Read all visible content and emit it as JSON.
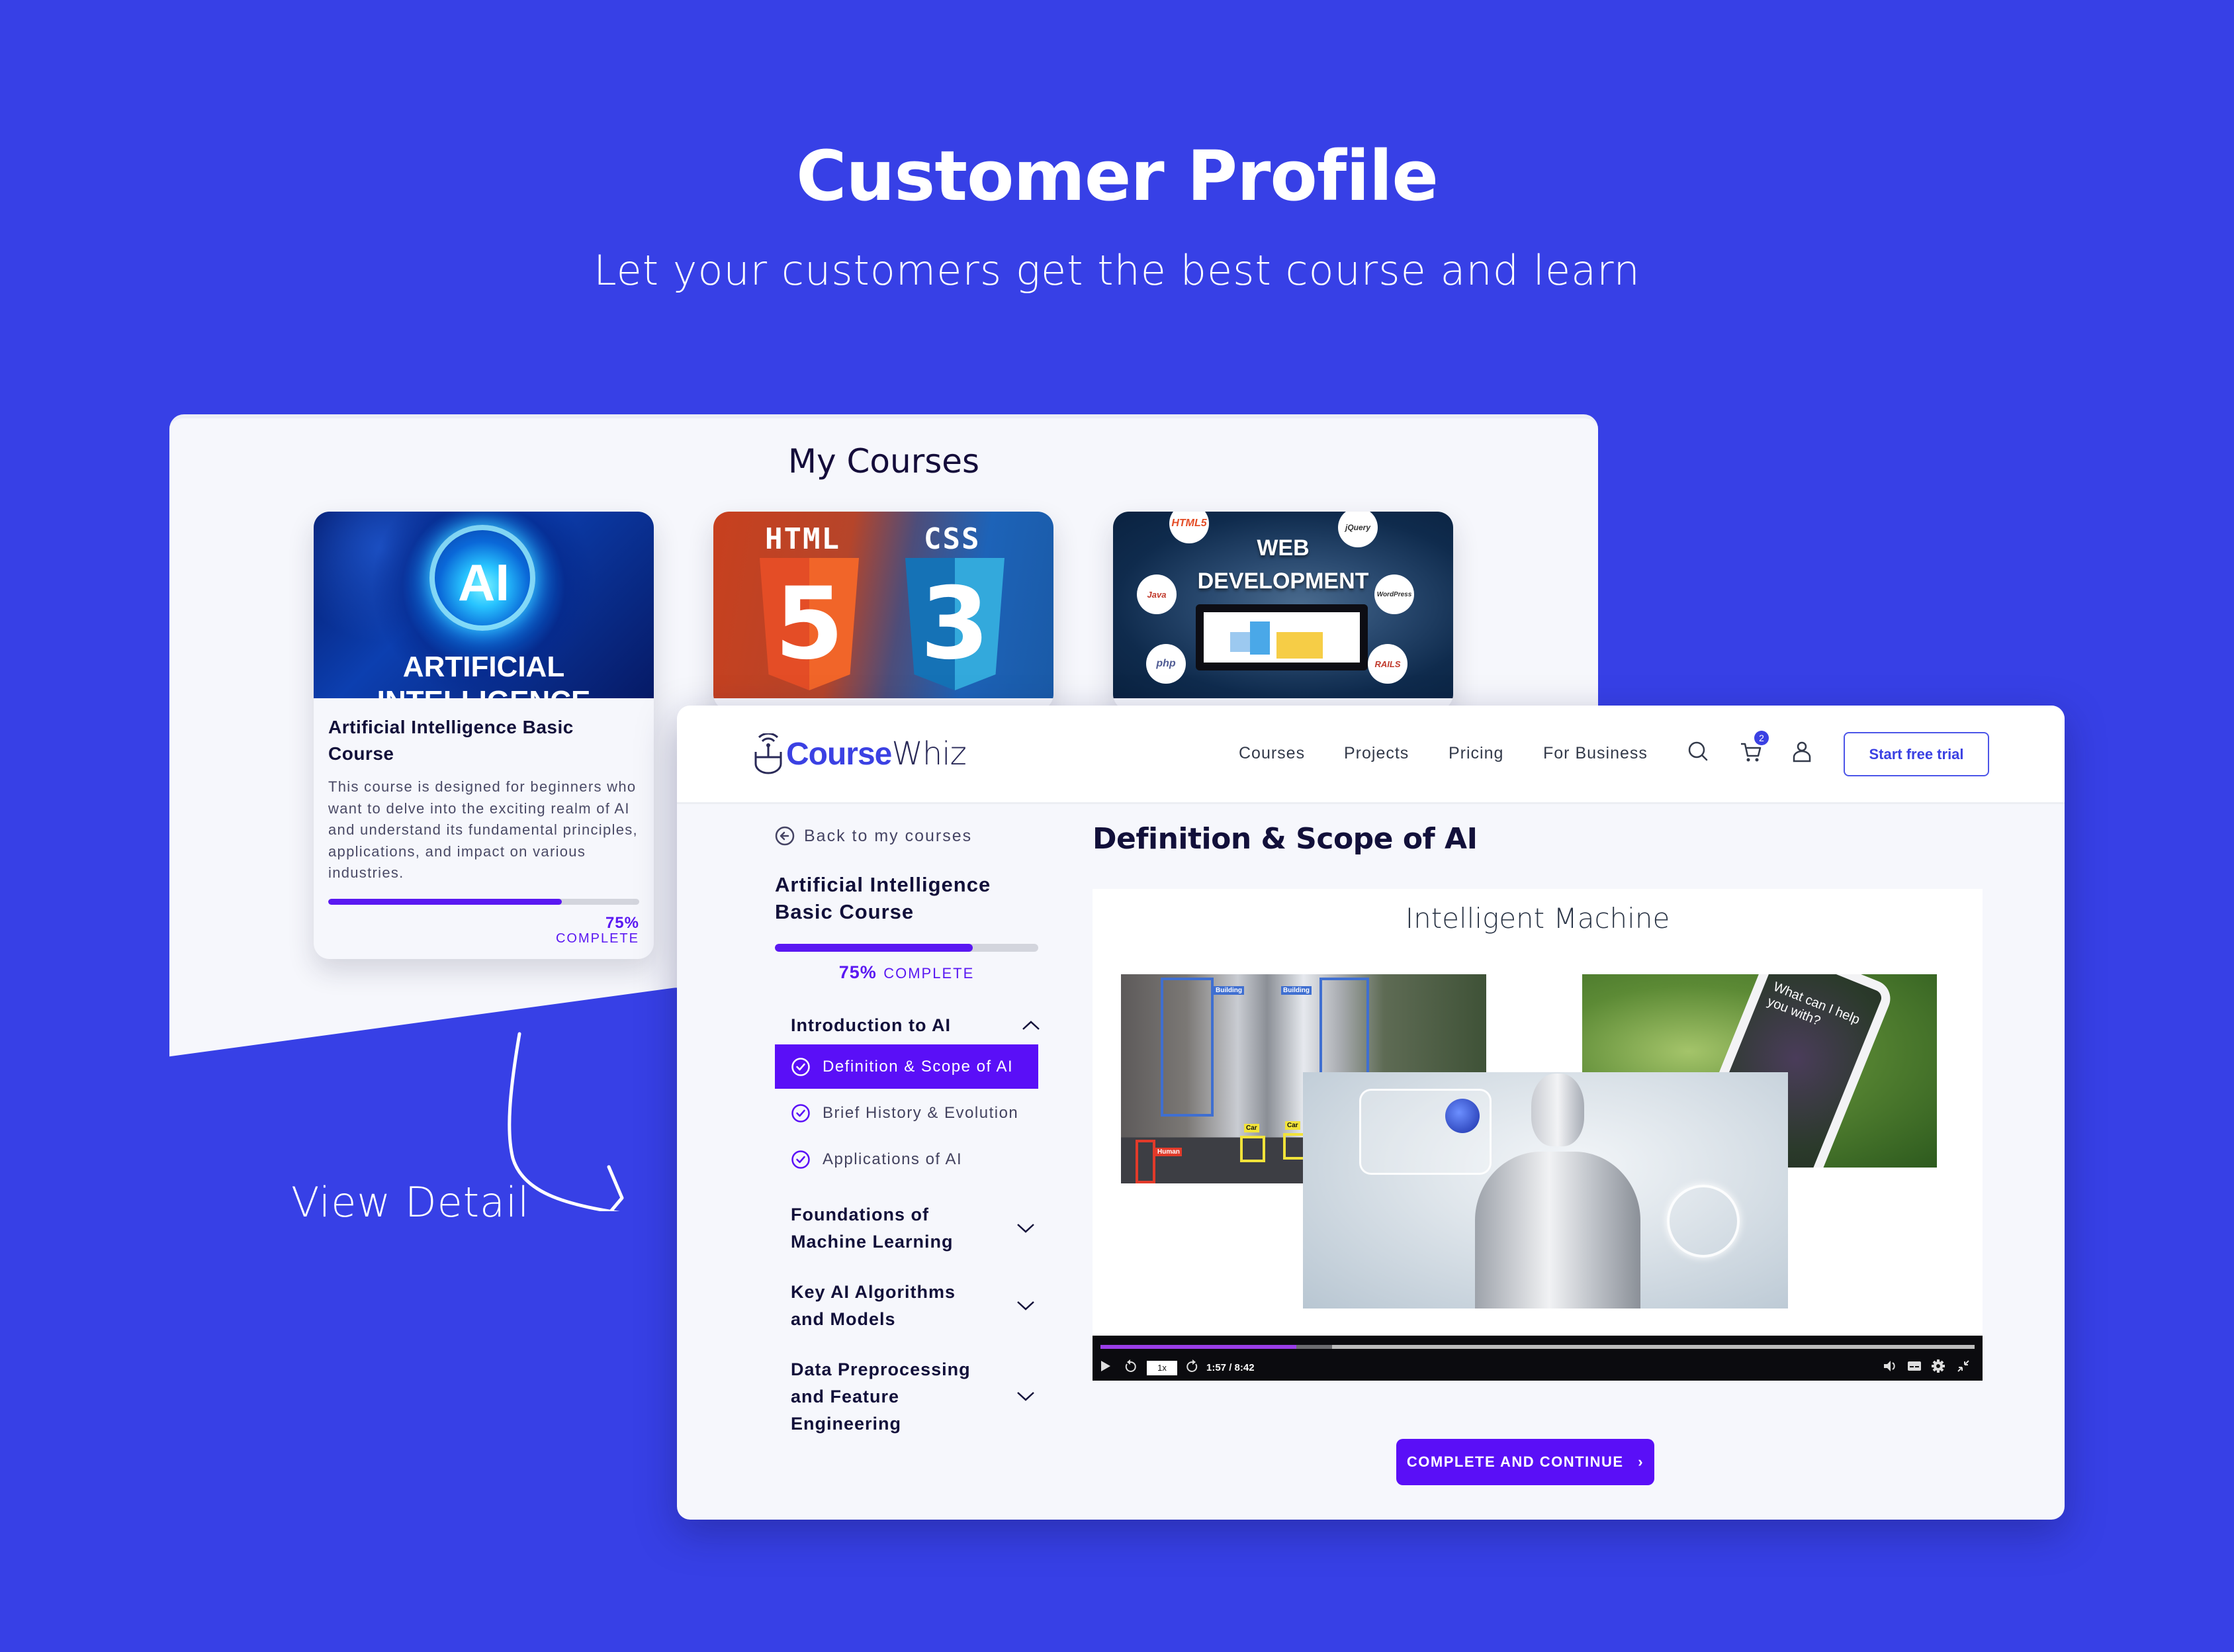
{
  "hero": {
    "title": "Customer Profile",
    "subtitle": "Let your customers get the best course and learn"
  },
  "my_courses": {
    "title": "My Courses",
    "cards": [
      {
        "image_text_top": "AI",
        "image_text_caption": "ARTIFICIAL",
        "image_text_caption2": "INTELLIGENCE",
        "title": "Artificial Intelligence Basic Course",
        "description": "This course is designed for beginners who want to delve into the exciting realm of AI and understand its fundamental principles, applications, and impact on various industries.",
        "progress": 0.75,
        "progress_pct": "75%",
        "progress_label": "COMPLETE"
      },
      {
        "image_label_left": "HTML",
        "image_label_right": "CSS",
        "shield_left": "5",
        "shield_right": "3"
      },
      {
        "image_text_1": "WEB",
        "image_text_2": "DEVELOPMENT",
        "tech_badges": [
          "HTML5",
          "jQuery",
          "Java",
          "WordPress",
          "php",
          "RAILS"
        ]
      }
    ]
  },
  "annotation": {
    "label": "View Detail"
  },
  "detail": {
    "logo": {
      "part1": "Course",
      "part2": "Whiz"
    },
    "nav": [
      "Courses",
      "Projects",
      "Pricing",
      "For Business"
    ],
    "cart_count": "2",
    "cta": "Start free trial",
    "sidebar": {
      "back_label": "Back to my courses",
      "course_title": "Artificial Intelligence Basic Course",
      "progress": 0.75,
      "progress_pct": "75%",
      "progress_label": "COMPLETE",
      "sections": [
        {
          "title": "Introduction to AI",
          "expanded": true,
          "lessons": [
            {
              "title": "Definition & Scope of AI",
              "active": true,
              "done": true
            },
            {
              "title": "Brief History & Evolution",
              "active": false,
              "done": true
            },
            {
              "title": "Applications of AI",
              "active": false,
              "done": true
            }
          ]
        },
        {
          "title": "Foundations of Machine Learning",
          "expanded": false
        },
        {
          "title": "Key AI Algorithms and Models",
          "expanded": false
        },
        {
          "title": "Data Preprocessing and Feature Engineering",
          "expanded": false
        }
      ]
    },
    "main": {
      "lesson_title": "Definition & Scope of AI",
      "video": {
        "heading": "Intelligent Machine",
        "labels": {
          "building": "Building",
          "car": "Car",
          "human": "Human"
        },
        "phone_prompt": "What can I help you with?",
        "speed": "1x",
        "timecode": "1:57 / 8:42",
        "played_fraction": 0.224,
        "buffered_fraction": 0.265
      },
      "continue_label": "COMPLETE AND CONTINUE"
    }
  },
  "colors": {
    "background": "#3740e6",
    "brand_blue": "#3b41e3",
    "accent_purple": "#5a0ff7",
    "video_progress": "#9a3de8",
    "text_dark": "#12103a"
  }
}
